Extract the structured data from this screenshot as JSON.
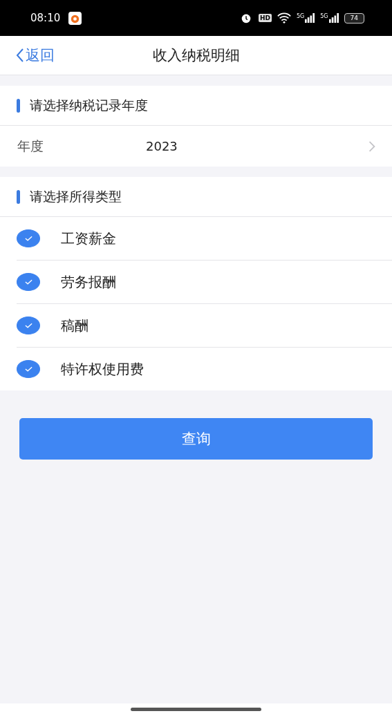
{
  "status_bar": {
    "time": "08:10",
    "hd": "HD",
    "networks": [
      "5G",
      "5G"
    ],
    "battery": "74"
  },
  "nav": {
    "back": "返回",
    "title": "收入纳税明细"
  },
  "year_section": {
    "heading": "请选择纳税记录年度",
    "label": "年度",
    "value": "2023"
  },
  "type_section": {
    "heading": "请选择所得类型",
    "options": [
      {
        "label": "工资薪金",
        "checked": true
      },
      {
        "label": "劳务报酬",
        "checked": true
      },
      {
        "label": "稿酬",
        "checked": true
      },
      {
        "label": "特许权使用费",
        "checked": true
      }
    ]
  },
  "query_button": "查询"
}
